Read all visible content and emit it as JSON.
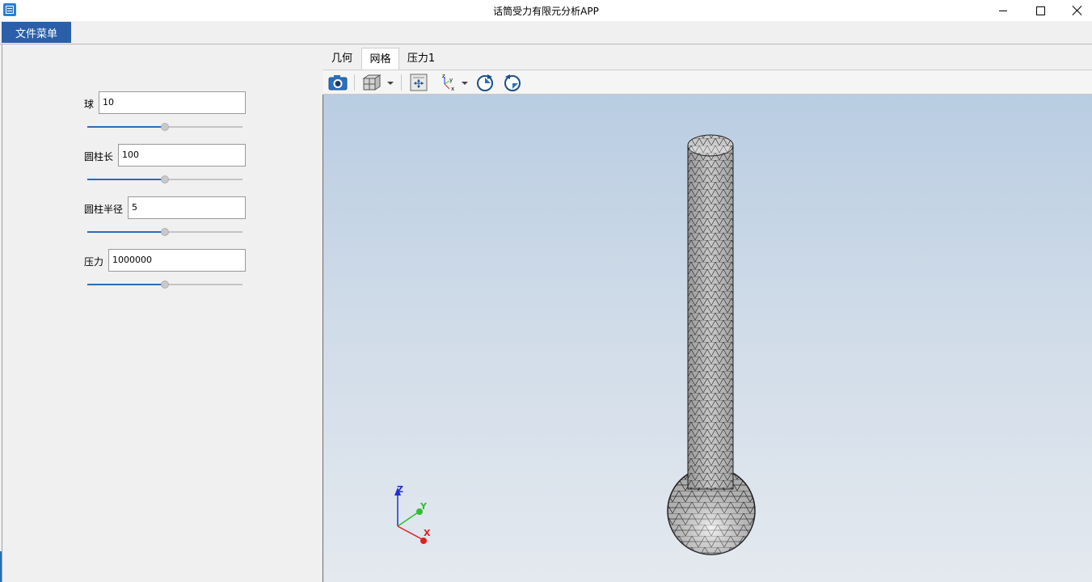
{
  "window": {
    "title": "话筒受力有限元分析APP"
  },
  "menu": {
    "file_label": "文件菜单"
  },
  "params": [
    {
      "label": "球",
      "value": "10",
      "slider_fraction": 0.5
    },
    {
      "label": "圆柱长",
      "value": "100",
      "slider_fraction": 0.5
    },
    {
      "label": "圆柱半径",
      "value": "5",
      "slider_fraction": 0.5
    },
    {
      "label": "压力",
      "value": "1000000",
      "slider_fraction": 0.5
    }
  ],
  "tabs": [
    {
      "label": "几何",
      "active": false
    },
    {
      "label": "网格",
      "active": true
    },
    {
      "label": "压力1",
      "active": false
    }
  ],
  "toolbar": {
    "icons": [
      "camera-icon",
      "view-cube-icon",
      "fit-view-icon",
      "axes-orientation-icon",
      "rotate-cw-icon",
      "rotate-ccw-icon"
    ]
  },
  "axes": {
    "x": "X",
    "y": "Y",
    "z": "Z"
  },
  "colors": {
    "accent": "#2b5fa8",
    "slider_fill": "#2b6cb8",
    "axis_x": "#e02020",
    "axis_y": "#2fbf2f",
    "axis_z": "#1f2fd6"
  }
}
